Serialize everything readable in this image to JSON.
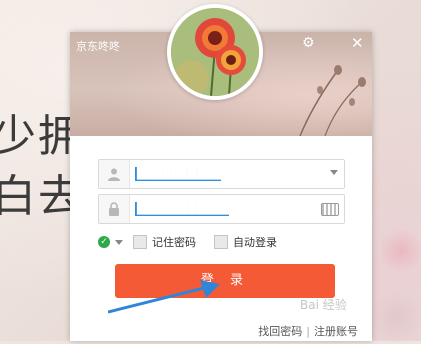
{
  "background": {
    "text_line1": "少拥有",
    "text_line2": "白去步"
  },
  "window": {
    "app_title": "京东咚咚",
    "settings_icon": "gear-icon",
    "close_icon": "close-icon"
  },
  "form": {
    "account_value": "████████████",
    "password_value": "████████████",
    "user_icon": "user-icon",
    "lock_icon": "lock-icon",
    "keyboard_icon": "keyboard-icon",
    "remember_password_label": "记住密码",
    "auto_login_label": "自动登录",
    "login_button_label": "登 录"
  },
  "footer": {
    "find_password": "找回密码",
    "register": "注册账号",
    "separator": "|"
  },
  "watermark": "Bai 经验",
  "colors": {
    "login_button": "#f45a36",
    "online_status": "#2ea84a",
    "highlight": "#2e8fe0",
    "annotation_arrow": "#2f86d8"
  }
}
